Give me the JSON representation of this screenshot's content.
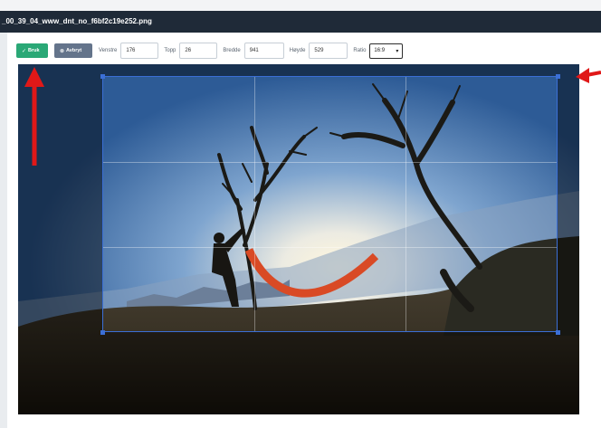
{
  "window": {
    "title": "_00_39_04_www_dnt_no_f6bf2c19e252.png"
  },
  "toolbar": {
    "apply_label": "Bruk",
    "cancel_label": "Avbryt",
    "left_label": "Venstre",
    "left_value": "176",
    "top_label": "Topp",
    "top_value": "26",
    "width_label": "Bredde",
    "width_value": "941",
    "height_label": "Høyde",
    "height_value": "529",
    "ratio_label": "Ratio",
    "ratio_value": "16:9"
  },
  "icons": {
    "apply": "check-icon",
    "cancel": "cancel-icon",
    "ratio_dropdown": "chevron-down-icon"
  },
  "colors": {
    "titlebar": "#1f2a38",
    "apply_button": "#2aa876",
    "cancel_button": "#64748b",
    "crop_border": "#3b6fd6",
    "annotation_arrow": "#e01818"
  }
}
